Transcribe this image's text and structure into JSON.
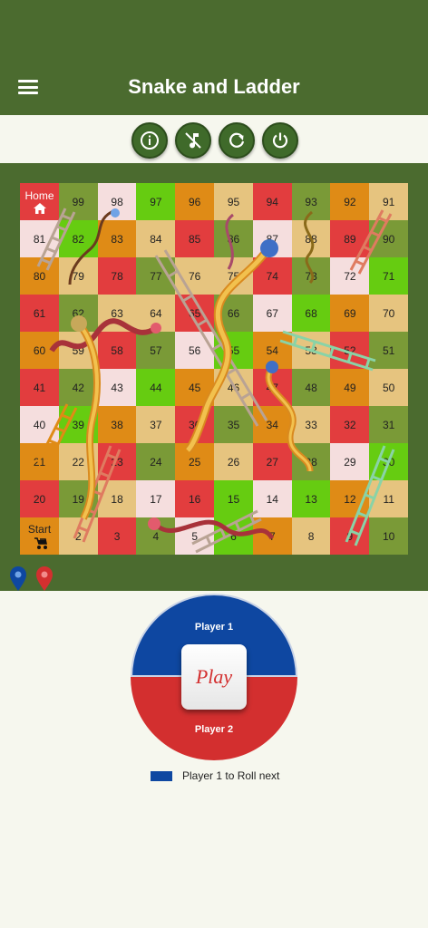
{
  "app": {
    "title": "Snake and Ladder"
  },
  "toolbar": {
    "buttons": [
      {
        "name": "info-button",
        "icon": "info-icon"
      },
      {
        "name": "mute-music-button",
        "icon": "music-off-icon"
      },
      {
        "name": "restart-button",
        "icon": "refresh-icon"
      },
      {
        "name": "power-button",
        "icon": "power-icon"
      }
    ]
  },
  "board": {
    "home_label": "Home",
    "start_label": "Start",
    "colors": {
      "red": "#e23d3e",
      "tan": "#e6c47f",
      "olive": "#7a9a37",
      "green": "#66cc11",
      "orange": "#df8b16",
      "pink": "#f5dede"
    },
    "rows": [
      [
        {
          "n": "100",
          "c": "red",
          "label": "Home"
        },
        {
          "n": "99",
          "c": "olive"
        },
        {
          "n": "98",
          "c": "pink"
        },
        {
          "n": "97",
          "c": "green"
        },
        {
          "n": "96",
          "c": "orange"
        },
        {
          "n": "95",
          "c": "tan"
        },
        {
          "n": "94",
          "c": "red"
        },
        {
          "n": "93",
          "c": "olive"
        },
        {
          "n": "92",
          "c": "orange"
        },
        {
          "n": "91",
          "c": "tan"
        }
      ],
      [
        {
          "n": "81",
          "c": "pink"
        },
        {
          "n": "82",
          "c": "green"
        },
        {
          "n": "83",
          "c": "orange"
        },
        {
          "n": "84",
          "c": "tan"
        },
        {
          "n": "85",
          "c": "red"
        },
        {
          "n": "86",
          "c": "olive"
        },
        {
          "n": "87",
          "c": "pink"
        },
        {
          "n": "88",
          "c": "tan"
        },
        {
          "n": "89",
          "c": "red"
        },
        {
          "n": "90",
          "c": "olive"
        }
      ],
      [
        {
          "n": "80",
          "c": "orange"
        },
        {
          "n": "79",
          "c": "tan"
        },
        {
          "n": "78",
          "c": "red"
        },
        {
          "n": "77",
          "c": "olive"
        },
        {
          "n": "76",
          "c": "tan"
        },
        {
          "n": "75",
          "c": "tan"
        },
        {
          "n": "74",
          "c": "red"
        },
        {
          "n": "73",
          "c": "olive"
        },
        {
          "n": "72",
          "c": "pink"
        },
        {
          "n": "71",
          "c": "green"
        }
      ],
      [
        {
          "n": "61",
          "c": "red"
        },
        {
          "n": "62",
          "c": "olive"
        },
        {
          "n": "63",
          "c": "tan"
        },
        {
          "n": "64",
          "c": "tan"
        },
        {
          "n": "65",
          "c": "red"
        },
        {
          "n": "66",
          "c": "olive"
        },
        {
          "n": "67",
          "c": "pink"
        },
        {
          "n": "68",
          "c": "green"
        },
        {
          "n": "69",
          "c": "orange"
        },
        {
          "n": "70",
          "c": "tan"
        }
      ],
      [
        {
          "n": "60",
          "c": "orange"
        },
        {
          "n": "59",
          "c": "tan"
        },
        {
          "n": "58",
          "c": "red"
        },
        {
          "n": "57",
          "c": "olive"
        },
        {
          "n": "56",
          "c": "pink"
        },
        {
          "n": "55",
          "c": "green"
        },
        {
          "n": "54",
          "c": "orange"
        },
        {
          "n": "53",
          "c": "tan"
        },
        {
          "n": "52",
          "c": "red"
        },
        {
          "n": "51",
          "c": "olive"
        }
      ],
      [
        {
          "n": "41",
          "c": "red"
        },
        {
          "n": "42",
          "c": "olive"
        },
        {
          "n": "43",
          "c": "pink"
        },
        {
          "n": "44",
          "c": "green"
        },
        {
          "n": "45",
          "c": "orange"
        },
        {
          "n": "46",
          "c": "tan"
        },
        {
          "n": "47",
          "c": "red"
        },
        {
          "n": "48",
          "c": "olive"
        },
        {
          "n": "49",
          "c": "orange"
        },
        {
          "n": "50",
          "c": "tan"
        }
      ],
      [
        {
          "n": "40",
          "c": "pink"
        },
        {
          "n": "39",
          "c": "green"
        },
        {
          "n": "38",
          "c": "orange"
        },
        {
          "n": "37",
          "c": "tan"
        },
        {
          "n": "36",
          "c": "red"
        },
        {
          "n": "35",
          "c": "olive"
        },
        {
          "n": "34",
          "c": "orange"
        },
        {
          "n": "33",
          "c": "tan"
        },
        {
          "n": "32",
          "c": "red"
        },
        {
          "n": "31",
          "c": "olive"
        }
      ],
      [
        {
          "n": "21",
          "c": "orange"
        },
        {
          "n": "22",
          "c": "tan"
        },
        {
          "n": "23",
          "c": "red"
        },
        {
          "n": "24",
          "c": "olive"
        },
        {
          "n": "25",
          "c": "orange"
        },
        {
          "n": "26",
          "c": "tan"
        },
        {
          "n": "27",
          "c": "red"
        },
        {
          "n": "28",
          "c": "olive"
        },
        {
          "n": "29",
          "c": "pink"
        },
        {
          "n": "30",
          "c": "green"
        }
      ],
      [
        {
          "n": "20",
          "c": "red"
        },
        {
          "n": "19",
          "c": "olive"
        },
        {
          "n": "18",
          "c": "tan"
        },
        {
          "n": "17",
          "c": "pink"
        },
        {
          "n": "16",
          "c": "red"
        },
        {
          "n": "15",
          "c": "green"
        },
        {
          "n": "14",
          "c": "pink"
        },
        {
          "n": "13",
          "c": "green"
        },
        {
          "n": "12",
          "c": "orange"
        },
        {
          "n": "11",
          "c": "tan"
        }
      ],
      [
        {
          "n": "1",
          "c": "orange",
          "label": "Start"
        },
        {
          "n": "2",
          "c": "tan"
        },
        {
          "n": "3",
          "c": "red"
        },
        {
          "n": "4",
          "c": "olive"
        },
        {
          "n": "5",
          "c": "pink"
        },
        {
          "n": "6",
          "c": "green"
        },
        {
          "n": "7",
          "c": "orange"
        },
        {
          "n": "8",
          "c": "tan"
        },
        {
          "n": "9",
          "c": "red"
        },
        {
          "n": "10",
          "c": "olive"
        }
      ]
    ]
  },
  "players": {
    "player1_label": "Player 1",
    "player2_label": "Player 2",
    "player1_color": "#0e47a1",
    "player2_color": "#d32f2f",
    "player1_marker_icon": "location-pin-icon",
    "player2_marker_icon": "location-pin-icon"
  },
  "dice": {
    "play_label": "Play"
  },
  "status": {
    "text": "Player 1 to Roll next",
    "swatch_color": "#0e47a1"
  }
}
